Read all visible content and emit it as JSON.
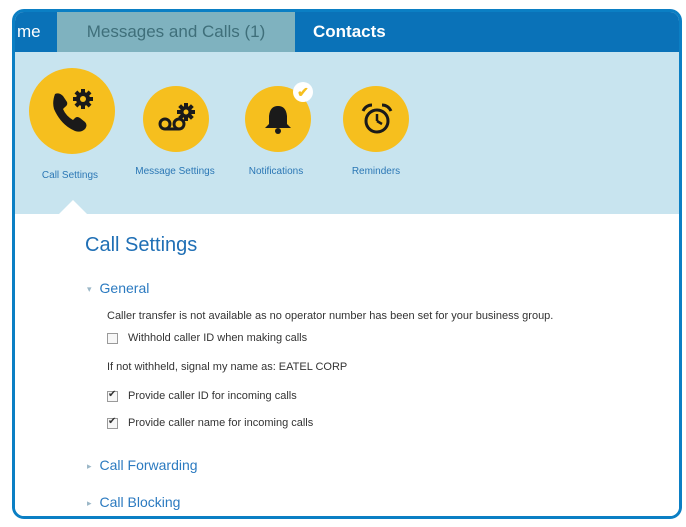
{
  "nav": {
    "home_label": "me",
    "messages_label": "Messages and Calls (1)",
    "contacts_label": "Contacts"
  },
  "toolbar": {
    "items": [
      {
        "label": "Call Settings",
        "icon": "phone-gear-icon"
      },
      {
        "label": "Message Settings",
        "icon": "voicemail-gear-icon"
      },
      {
        "label": "Notifications",
        "icon": "bell-icon",
        "badge": "check-badge-icon"
      },
      {
        "label": "Reminders",
        "icon": "alarm-clock-icon"
      }
    ]
  },
  "main": {
    "title": "Call Settings",
    "general": {
      "label": "General",
      "transfer_note": "Caller transfer is not available as no operator number has been set for your business group.",
      "withhold_label": "Withhold caller ID when making calls",
      "withhold_checked": false,
      "signal_name_text": "If not withheld, signal my name as: EATEL CORP",
      "provide_id_label": "Provide caller ID for incoming calls",
      "provide_id_checked": true,
      "provide_name_label": "Provide caller name for incoming calls",
      "provide_name_checked": true
    },
    "call_forwarding_label": "Call Forwarding",
    "call_blocking_label": "Call Blocking"
  },
  "colors": {
    "nav_bar": "#0a72b8",
    "active_tab": "#7fb2bf",
    "icon_bar": "#c8e4ef",
    "icon_circle": "#f6bf1e",
    "link_blue": "#2b7ac0",
    "frame_border": "#0b7fc4"
  }
}
